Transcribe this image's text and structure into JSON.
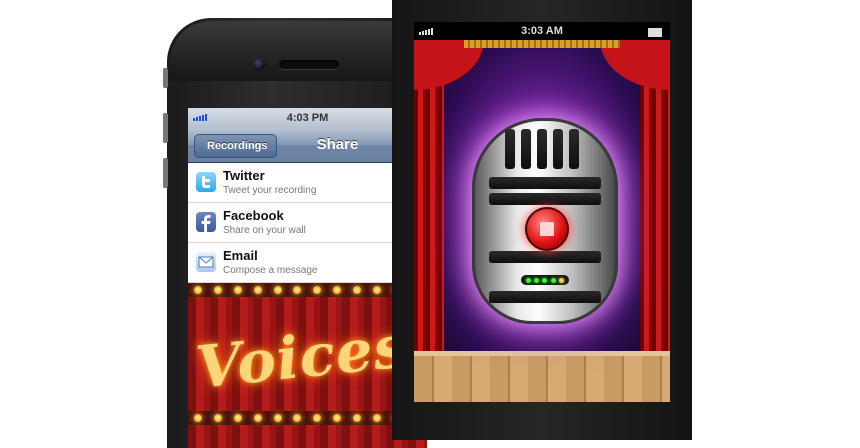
{
  "left_phone": {
    "status": {
      "time": "4:03 PM"
    },
    "navbar": {
      "back_label": "Recordings",
      "title": "Share"
    },
    "share_options": [
      {
        "name": "Twitter",
        "description": "Tweet your recording",
        "icon": "twitter-icon"
      },
      {
        "name": "Facebook",
        "description": "Share on your wall",
        "icon": "facebook-icon"
      },
      {
        "name": "Email",
        "description": "Compose a message",
        "icon": "email-icon"
      }
    ],
    "banner_text": "Voices"
  },
  "right_phone": {
    "status": {
      "time": "3:03 AM"
    },
    "record_button": {
      "icon": "stop-icon",
      "color": "#e01313"
    },
    "level_meter": {
      "lights": [
        "#3cf03c",
        "#3cf03c",
        "#3cf03c",
        "#3cf03c",
        "#f0d63c"
      ]
    }
  }
}
